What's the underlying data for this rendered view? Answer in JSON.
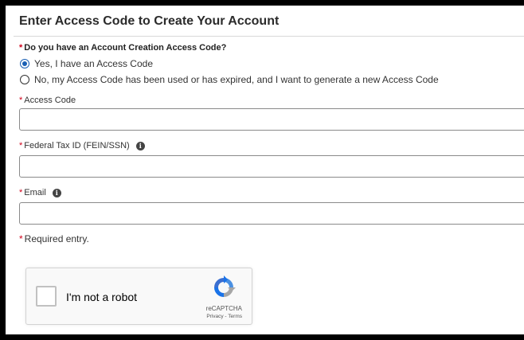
{
  "form": {
    "title": "Enter Access Code to Create Your Account",
    "required_star": "*",
    "question": "Do you have an Account Creation Access Code?",
    "options": [
      {
        "label": "Yes, I have an Access Code",
        "selected": true
      },
      {
        "label": "No, my Access Code has been used or has expired, and I want to generate a new Access Code",
        "selected": false
      }
    ],
    "fields": {
      "access_code": {
        "label": "Access Code",
        "value": ""
      },
      "federal_tax_id": {
        "label": "Federal Tax ID (FEIN/SSN)",
        "value": "",
        "info_icon": "info-icon"
      },
      "email": {
        "label": "Email",
        "value": "",
        "info_icon": "info-icon"
      }
    },
    "required_note": "Required entry."
  },
  "recaptcha": {
    "label": "I'm not a robot",
    "brand": "reCAPTCHA",
    "privacy": "Privacy",
    "separator": " - ",
    "terms": "Terms",
    "checked": false
  },
  "colors": {
    "required": "#d0021b",
    "radio_selected": "#1a5fb4",
    "border": "#8a8a8a"
  }
}
